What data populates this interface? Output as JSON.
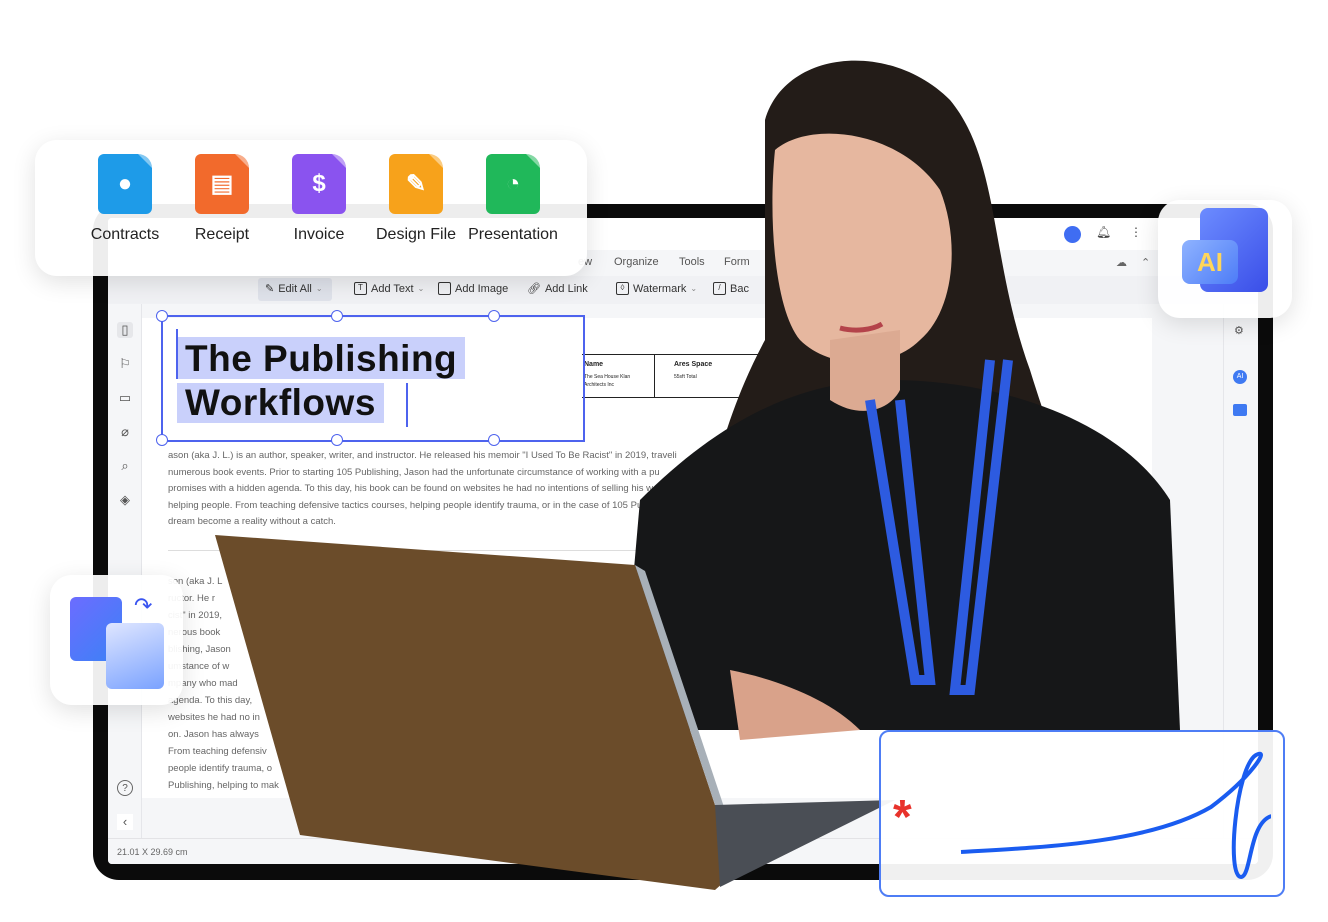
{
  "file_types": [
    {
      "label": "Contracts",
      "color": "#1e9be8",
      "icon": "person-icon"
    },
    {
      "label": "Receipt",
      "color": "#f26a2c",
      "icon": "receipt-icon"
    },
    {
      "label": "Invoice",
      "color": "#8a53ef",
      "icon": "dollar-icon"
    },
    {
      "label": "Design File",
      "color": "#f7a21b",
      "icon": "pencil-ruler-icon"
    },
    {
      "label": "Presentation",
      "color": "#20b85a",
      "icon": "pie-chart-icon"
    }
  ],
  "menu": {
    "items": [
      "ew",
      "Organize",
      "Tools",
      "Form"
    ]
  },
  "toolbar": {
    "edit_all": "Edit All",
    "add_text": "Add Text",
    "add_image": "Add Image",
    "add_link": "Add Link",
    "watermark": "Watermark",
    "background": "Bac"
  },
  "document": {
    "heading_line1": "The Publishing",
    "heading_line2": "Workflows",
    "table": {
      "col1_header": "Name",
      "col1_value_1": "The Sea House Klan",
      "col1_value_2": "Architects Inc",
      "col2_header": "Ares Space",
      "col2_value": "55sft Total"
    },
    "paragraph1": [
      "ason (aka J. L.) is an author, speaker, writer, and instructor. He released his memoir \"I Used To Be Racist\" in 2019, traveli",
      "numerous book events. Prior to starting 105 Publishing, Jason had the unfortunate circumstance of working with a pu",
      "promises with a hidden agenda. To this day, his book can be found on websites he had no intentions of selling his w",
      "helping people. From teaching defensive tactics courses, helping people identify trauma, or in the case of 105 Pu",
      "dream become a reality without a catch."
    ],
    "paragraph2": [
      "son (aka J. L",
      "ructor. He r",
      "cist\" in 2019,",
      "nerous book",
      "blishing, Jason",
      "umstance of w",
      "mpany who mad",
      "agenda. To this day,",
      "websites he had no in",
      "on. Jason has always",
      "From teaching defensiv",
      "people identify trauma, o",
      "Publishing, helping to mak"
    ]
  },
  "status": {
    "page_size": "21.01 X 29.69 cm"
  },
  "ai_badge": "AI",
  "colors": {
    "accent": "#4e63ee",
    "signature": "#1a5cf0",
    "asterisk": "#e8322b"
  }
}
